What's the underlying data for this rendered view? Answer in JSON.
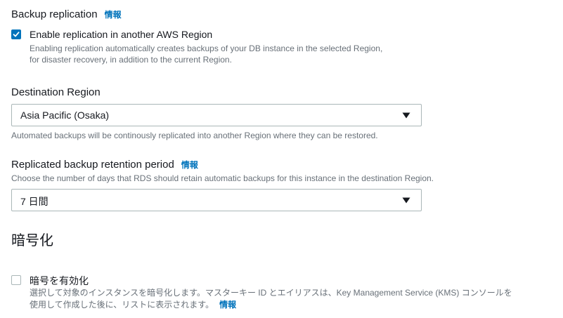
{
  "backup_replication": {
    "label": "Backup replication",
    "info_link": "情報",
    "enable_checkbox": {
      "checked": true,
      "title": "Enable replication in another AWS Region",
      "description_line1": "Enabling replication automatically creates backups of your DB instance in the selected Region,",
      "description_line2": "for disaster recovery, in addition to the current Region."
    }
  },
  "destination_region": {
    "label": "Destination Region",
    "selected_value": "Asia Pacific (Osaka)",
    "hint": "Automated backups will be continously replicated into another Region where they can be restored."
  },
  "retention_period": {
    "label": "Replicated backup retention period",
    "info_link": "情報",
    "description": "Choose the number of days that RDS should retain automatic backups for this instance in the destination Region.",
    "selected_value": "7 日間"
  },
  "encryption": {
    "heading": "暗号化",
    "checkbox": {
      "checked": false,
      "title": "暗号を有効化",
      "description_line1": "選択して対象のインスタンスを暗号化します。マスターキー ID とエイリアスは、Key Management Service (KMS) コンソールを",
      "description_line2": "使用して作成した後に、リストに表示されます。",
      "info_link": "情報"
    }
  },
  "colors": {
    "accent": "#0073bb",
    "text": "#16191f",
    "secondary_text": "#687078",
    "border": "#aab7b8"
  },
  "icons": {
    "checkbox_check": "checkmark-icon",
    "select_caret": "caret-down-icon"
  }
}
